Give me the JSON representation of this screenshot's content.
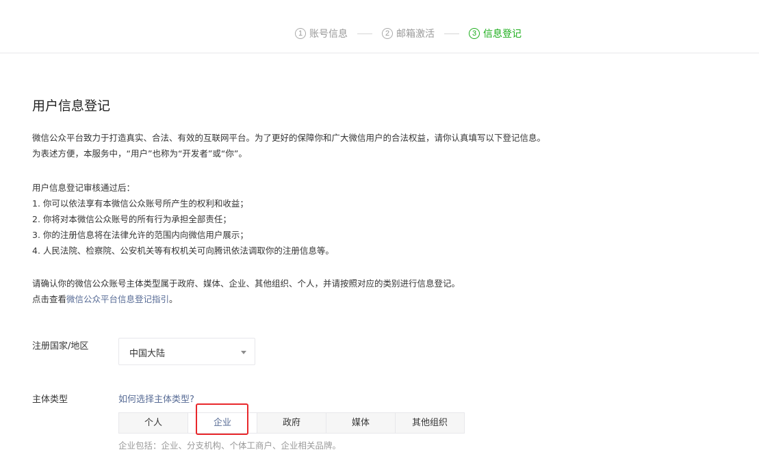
{
  "steps": [
    {
      "num": "1",
      "label": "账号信息",
      "state": "done"
    },
    {
      "num": "2",
      "label": "邮箱激活",
      "state": "done"
    },
    {
      "num": "3",
      "label": "信息登记",
      "state": "active"
    }
  ],
  "page_title": "用户信息登记",
  "intro": {
    "line1": "微信公众平台致力于打造真实、合法、有效的互联网平台。为了更好的保障你和广大微信用户的合法权益，请你认真填写以下登记信息。",
    "line2": "为表述方便，本服务中，“用户”也称为“开发者”或“你”。"
  },
  "benefits": {
    "heading": "用户信息登记审核通过后：",
    "items": [
      "1. 你可以依法享有本微信公众账号所产生的权利和收益；",
      "2. 你将对本微信公众账号的所有行为承担全部责任；",
      "3. 你的注册信息将在法律允许的范围内向微信用户展示；",
      "4. 人民法院、检察院、公安机关等有权机关可向腾讯依法调取你的注册信息等。"
    ]
  },
  "confirm": {
    "line1": "请确认你的微信公众账号主体类型属于政府、媒体、企业、其他组织、个人，并请按照对应的类别进行信息登记。",
    "line2_prefix": "点击查看",
    "line2_link": "微信公众平台信息登记指引",
    "line2_suffix": "。"
  },
  "form": {
    "country_label": "注册国家/地区",
    "country_value": "中国大陆",
    "type_label": "主体类型",
    "type_help_link": "如何选择主体类型?",
    "types": [
      {
        "label": "个人",
        "selected": false
      },
      {
        "label": "企业",
        "selected": true
      },
      {
        "label": "政府",
        "selected": false
      },
      {
        "label": "媒体",
        "selected": false
      },
      {
        "label": "其他组织",
        "selected": false
      }
    ],
    "type_description": "企业包括：企业、分支机构、个体工商户、企业相关品牌。"
  },
  "colors": {
    "accent_green": "#1aad19",
    "link_blue": "#576b95",
    "highlight_red": "#e8262a"
  }
}
